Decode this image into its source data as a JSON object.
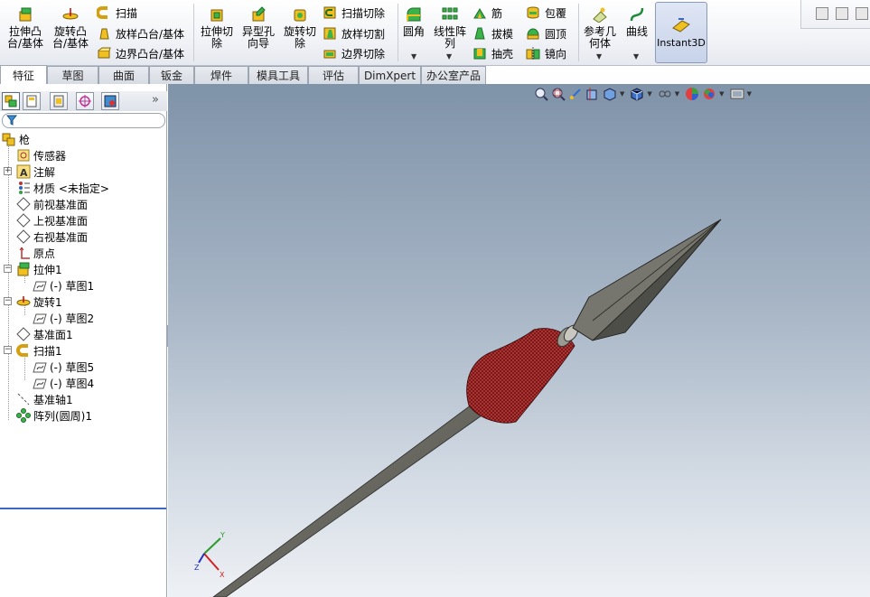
{
  "ribbon": {
    "extrude_boss_label": "拉伸凸\n台/基体",
    "revolve_boss_label": "旋转凸\n台/基体",
    "sweep_label": "扫描",
    "loft_boss_label": "放样凸台/基体",
    "boundary_boss_label": "边界凸台/基体",
    "extrude_cut_label": "拉伸切\n除",
    "hole_wizard_label": "异型孔\n向导",
    "revolve_cut_label": "旋转切\n除",
    "swept_cut_label": "扫描切除",
    "lofted_cut_label": "放样切割",
    "boundary_cut_label": "边界切除",
    "fillet_label": "圆角",
    "linear_pattern_label": "线性阵\n列",
    "rib_label": "筋",
    "draft_label": "拔模",
    "shell_label": "抽壳",
    "wrap_label": "包覆",
    "dome_label": "圆顶",
    "mirror_label": "镜向",
    "ref_geometry_label": "参考几\n何体",
    "curves_label": "曲线",
    "instant3d_label": "Instant3D"
  },
  "tabs": [
    "特征",
    "草图",
    "曲面",
    "钣金",
    "焊件",
    "模具工具",
    "评估",
    "DimXpert",
    "办公室产品"
  ],
  "active_tab": "特征",
  "tree": {
    "root": "枪",
    "items": [
      {
        "label": "传感器",
        "icon": "sensor-icon"
      },
      {
        "label": "注解",
        "icon": "annotation-icon"
      },
      {
        "label": "材质 <未指定>",
        "icon": "material-icon"
      },
      {
        "label": "前视基准面",
        "icon": "plane-icon"
      },
      {
        "label": "上视基准面",
        "icon": "plane-icon"
      },
      {
        "label": "右视基准面",
        "icon": "plane-icon"
      },
      {
        "label": "原点",
        "icon": "origin-icon"
      },
      {
        "label": "拉伸1",
        "icon": "extrude-icon"
      },
      {
        "label": "(-) 草图1",
        "icon": "sketch-icon"
      },
      {
        "label": "旋转1",
        "icon": "revolve-icon"
      },
      {
        "label": "(-) 草图2",
        "icon": "sketch-icon"
      },
      {
        "label": "基准面1",
        "icon": "plane-icon"
      },
      {
        "label": "扫描1",
        "icon": "sweep-icon"
      },
      {
        "label": "(-) 草图5",
        "icon": "sketch-icon"
      },
      {
        "label": "(-) 草图4",
        "icon": "sketch-icon"
      },
      {
        "label": "基准轴1",
        "icon": "axis-icon"
      },
      {
        "label": "阵列(圆周)1",
        "icon": "circular-pattern-icon"
      }
    ]
  },
  "panel": {
    "expand_glyph": "»"
  },
  "triad": {
    "x": "X",
    "y": "Y",
    "z": "Z"
  },
  "colors": {
    "viewport_top": "#7f93a9",
    "viewport_bottom": "#eef1f5",
    "model_gray": "#6b6b6b",
    "tassel_red": "#8b1a1a",
    "accent_blue": "#3b67c2"
  }
}
